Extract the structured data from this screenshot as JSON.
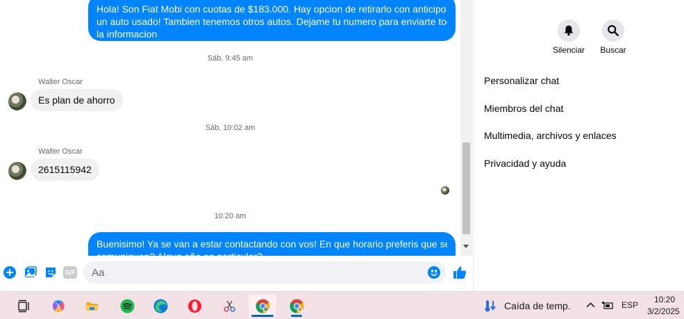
{
  "chat": {
    "messages": {
      "m1_line1": "Hola! Son Fiat Mobi con cuotas de $183.000. Hay opcion de retirarlo con anticipo o",
      "m1_line2": "un auto usado! Tambien tenemos otros autos. Dejame tu numero para enviarte toda",
      "m1_line3": "la informacion",
      "t1": "Sáb, 9:45 am",
      "sender1": "Walter Oscar",
      "m2": "Es plan de ahorro",
      "t2": "Sáb, 10:02 am",
      "sender2": "Walter Oscar",
      "m3": "2615115942",
      "t3": "10:20 am",
      "m4_line1": "Buenisimo! Ya se van a estar contactando con vos! En que horario preferis que se",
      "m4_line2": "comuniquen? Algun año en particular?"
    }
  },
  "composer": {
    "placeholder": "Aa",
    "icons": [
      "plus-icon",
      "image-icon",
      "sticker-icon",
      "gif-icon",
      "emoji-icon",
      "thumbs-up-icon"
    ],
    "gif_label": "GIF"
  },
  "panel": {
    "mute_label": "Silenciar",
    "search_label": "Buscar",
    "menu": [
      "Personalizar chat",
      "Miembros del chat",
      "Multimedia, archivos y enlaces",
      "Privacidad y ayuda"
    ]
  },
  "taskbar": {
    "apps": [
      "task-view",
      "copilot",
      "file-explorer",
      "spotify",
      "edge",
      "opera",
      "snipping-tool",
      "chrome-1",
      "chrome-2"
    ],
    "weather": "Caída de temp.",
    "language": "ESP",
    "time": "10:20",
    "date": "3/2/2025"
  },
  "colors": {
    "accent": "#0084ff",
    "bubble_in": "#f0f0f0",
    "taskbar": "#f2e1e5"
  }
}
